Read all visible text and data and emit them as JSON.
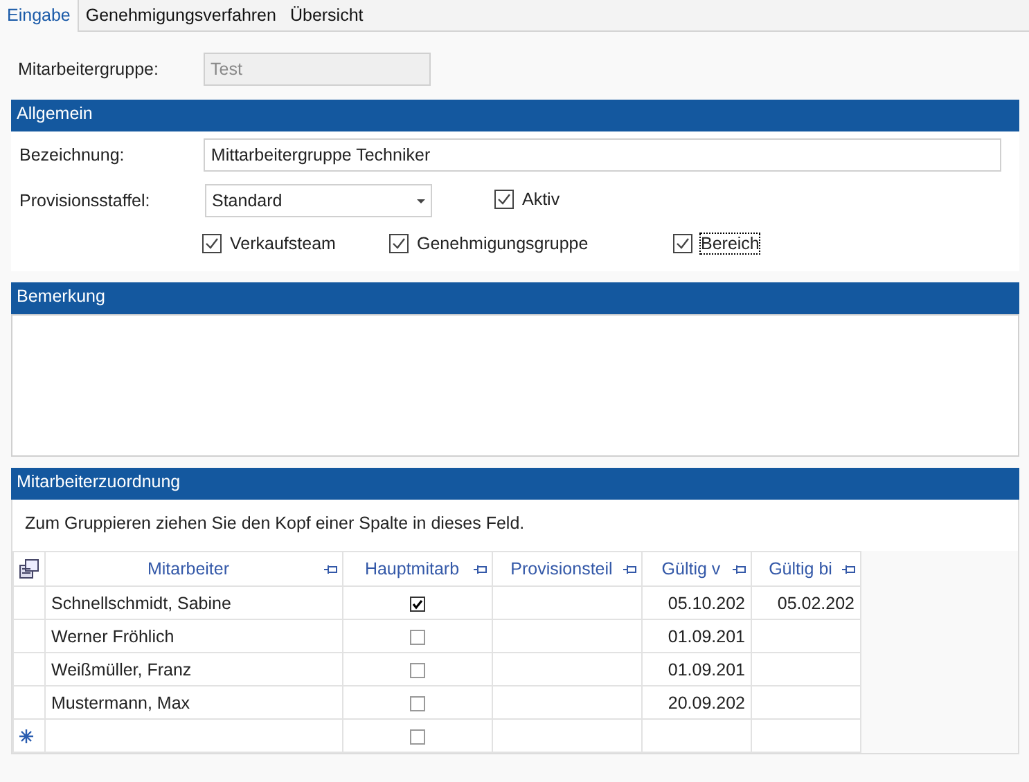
{
  "tabs": [
    {
      "label": "Eingabe",
      "selected": true
    },
    {
      "label": "Genehmigungsverfahren",
      "selected": false
    },
    {
      "label": "Übersicht",
      "selected": false
    }
  ],
  "group_field": {
    "label": "Mitarbeitergruppe:",
    "value": "Test",
    "disabled": true
  },
  "general": {
    "title": "Allgemein",
    "name_field": {
      "label": "Bezeichnung:",
      "value": "Mittarbeitergruppe Techniker"
    },
    "commission_field": {
      "label": "Provisionsstaffel:",
      "value": "Standard"
    },
    "active": {
      "label": "Aktiv",
      "checked": true,
      "focused": false
    },
    "checkboxes": [
      {
        "label": "Verkaufsteam",
        "checked": true,
        "focused": false
      },
      {
        "label": "Genehmigungsgruppe",
        "checked": true,
        "focused": false
      },
      {
        "label": "Bereich",
        "checked": true,
        "focused": true
      }
    ]
  },
  "remark": {
    "title": "Bemerkung"
  },
  "assignment": {
    "title": "Mitarbeiterzuordnung",
    "group_hint": "Zum Gruppieren ziehen Sie den Kopf einer Spalte in dieses Feld.",
    "columns": [
      "Mitarbeiter",
      "Hauptmitarb",
      "Provisionsteil",
      "Gültig v",
      "Gültig bi"
    ],
    "rows": [
      {
        "kind": "data",
        "employee": "Schnellschmidt, Sabine",
        "main": true,
        "share": "",
        "valid_from": "05.10.202",
        "valid_to": "05.02.202"
      },
      {
        "kind": "data",
        "employee": "Werner Fröhlich",
        "main": false,
        "share": "",
        "valid_from": "01.09.201",
        "valid_to": ""
      },
      {
        "kind": "data",
        "employee": "Weißmüller, Franz",
        "main": false,
        "share": "",
        "valid_from": "01.09.201",
        "valid_to": ""
      },
      {
        "kind": "data",
        "employee": "Mustermann, Max",
        "main": false,
        "share": "",
        "valid_from": "20.09.202",
        "valid_to": ""
      },
      {
        "kind": "new",
        "employee": "",
        "main": false,
        "share": "",
        "valid_from": "",
        "valid_to": ""
      }
    ]
  }
}
